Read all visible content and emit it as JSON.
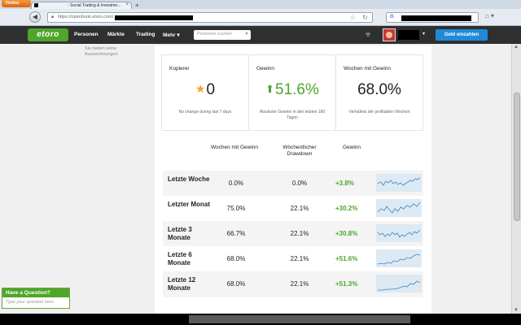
{
  "browser": {
    "menu_button": "Firefox",
    "tab_title": "- Social Trading & Investme...",
    "url": "https://openbook.etoro.com/",
    "search_engine": "G"
  },
  "header": {
    "logo": "etoro",
    "menu": [
      "Personen",
      "Märkte",
      "Trading",
      "Mehr"
    ],
    "search_placeholder": "Personen suchen",
    "deposit_label": "Geld einzahlen"
  },
  "left": {
    "awards_note": "Sie haben keine Auszeichnungen"
  },
  "stats": [
    {
      "label": "Kopierer",
      "value": "0",
      "sub": "No change during last 7 days"
    },
    {
      "label": "Gewinn",
      "value": "51.6%",
      "sub": "Absoluter Gewinn in den letzten 180 Tagen"
    },
    {
      "label": "Wochen mit Gewinn",
      "value": "68.0%",
      "sub": "Verhältnis der profitablen Wochen"
    }
  ],
  "table": {
    "headers": [
      "Wochen mit Gewinn",
      "Wöchentlicher Drawdown",
      "Gewinn"
    ],
    "rows": [
      {
        "period": "Letzte Woche",
        "weeks": "0.0%",
        "drawdown": "0.0%",
        "gain": "3.8%"
      },
      {
        "period": "Letzter Monat",
        "weeks": "75.0%",
        "drawdown": "22.1%",
        "gain": "30.2%"
      },
      {
        "period": "Letzte 3 Monate",
        "weeks": "66.7%",
        "drawdown": "22.1%",
        "gain": "30.8%"
      },
      {
        "period": "Letzte 6 Monate",
        "weeks": "68.0%",
        "drawdown": "22.1%",
        "gain": "51.6%"
      },
      {
        "period": "Letzte 12 Monate",
        "weeks": "68.0%",
        "drawdown": "22.1%",
        "gain": "51.3%"
      }
    ]
  },
  "question_widget": {
    "title": "Have a Question?",
    "placeholder": "Type your question here"
  },
  "colors": {
    "accent_green": "#4ea62a",
    "deposit_blue": "#1f8bd8",
    "header_dark": "#2e2f31"
  }
}
